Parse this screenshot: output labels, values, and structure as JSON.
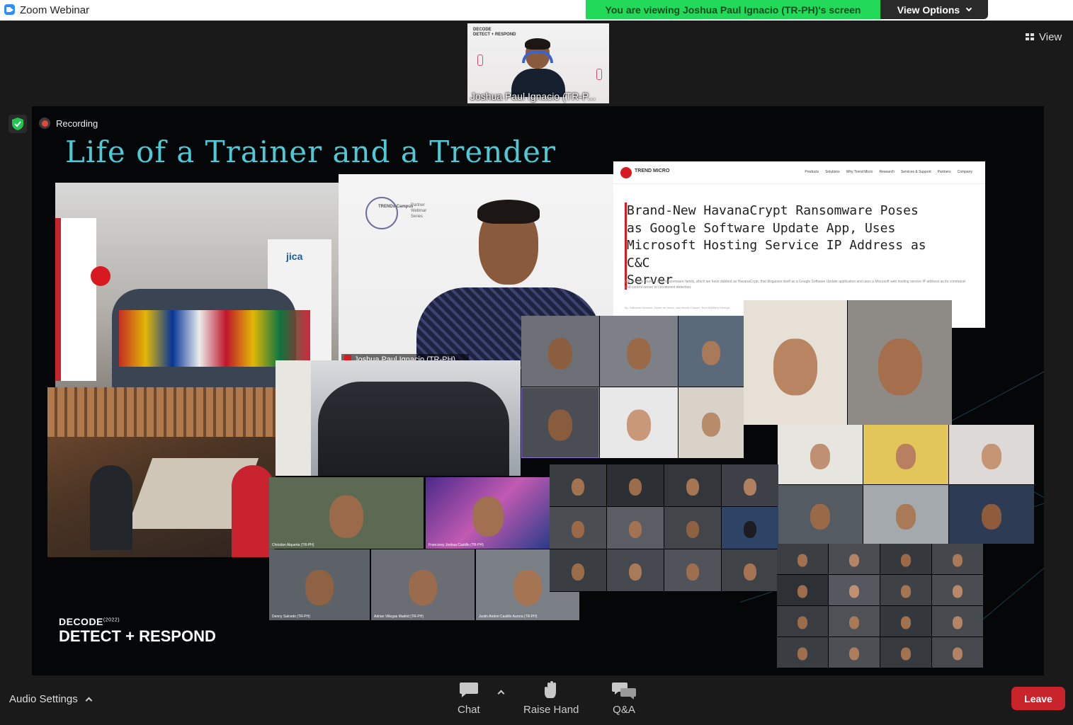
{
  "window": {
    "title": "Zoom Webinar",
    "share_banner": "You are viewing Joshua Paul Ignacio (TR-PH)'s screen",
    "view_options_label": "View Options",
    "view_button_label": "View"
  },
  "speaker": {
    "name": "Joshua Paul Ignacio (TR-P...",
    "brand_line1": "DECODE",
    "brand_line2": "DETECT + RESPOND"
  },
  "recording_label": "Recording",
  "slide": {
    "title": "Life of a Trainer and a Trender",
    "video_caption": "Joshua Paul Ignacio (TR-PH)",
    "campus_logo": "TRENDs Campus",
    "campus_series": "Partner Webinar Series",
    "article": {
      "logo_text": "TREND MICRO",
      "nav_links": [
        "Products",
        "Solutions",
        "Why Trend Micro",
        "Research",
        "Services & Support",
        "Partners",
        "Company"
      ],
      "headline_lines": [
        "Brand-New HavanaCrypt Ransomware Poses",
        "as Google Software Update App, Uses",
        "Microsoft Hosting Service IP Address as C&C",
        "Server"
      ],
      "lede": "We recently found a new ransomware family, which we have dubbed as HavanaCrypt, that disguises itself as a Google Software Update application and uses a Microsoft web hosting service IP address as its command-and-control server to circumvent detection.",
      "byline": "By: Nathaniel Morales, Monte de Jesus, Ivan Nicole Chavez, Bren Matthew Ebriega"
    },
    "event_logo_line1": "DECODE",
    "event_logo_year": "(2022)",
    "event_logo_line2": "DETECT + RESPOND"
  },
  "toolbar": {
    "audio_settings_label": "Audio Settings",
    "chat_label": "Chat",
    "raise_hand_label": "Raise Hand",
    "qa_label": "Q&A",
    "leave_label": "Leave"
  },
  "colors": {
    "share_banner_bg": "#23d959",
    "slide_title": "#4ec9d6",
    "leave_button": "#c9242b",
    "trend_red": "#d71920"
  }
}
